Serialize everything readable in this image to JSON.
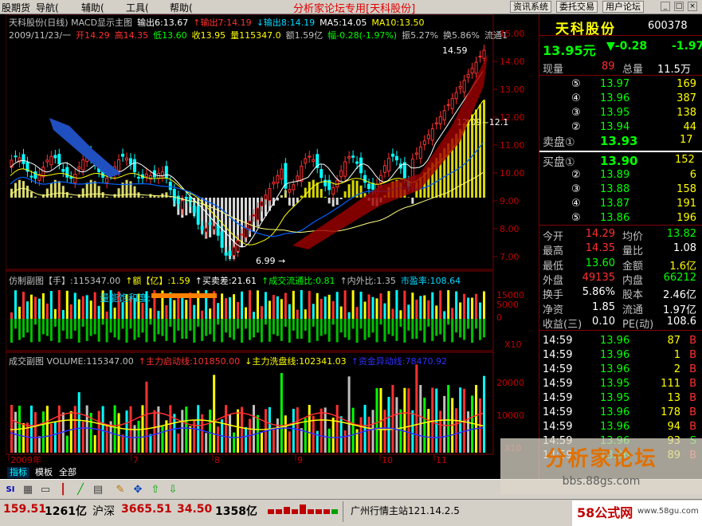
{
  "menu": {
    "items": [
      "股期货",
      "导航(",
      "辅助(",
      "工具(",
      "帮助("
    ],
    "title": "分析家论坛专用[天科股份]",
    "buttons": [
      "资讯系统",
      "委托交易",
      "用户论坛"
    ]
  },
  "main_header": {
    "line1": [
      {
        "t": "天科股份(日线) MACD显示主图",
        "c": "#c0c0c0"
      },
      {
        "t": "输出6:13.67",
        "c": "#ffffff"
      },
      {
        "t": "↑输出7:14.19",
        "c": "#ff3030"
      },
      {
        "t": "↓输出8:14.19",
        "c": "#00d8ff"
      },
      {
        "t": "MA5:14.05",
        "c": "#ffffff"
      },
      {
        "t": "MA10:13.50",
        "c": "#ffff00"
      }
    ],
    "line2": [
      {
        "t": "2009/11/23/一",
        "c": "#c0c0c0"
      },
      {
        "t": "开14.29",
        "c": "#ff3030"
      },
      {
        "t": "高14.35",
        "c": "#ff3030"
      },
      {
        "t": "低13.60",
        "c": "#00ff00"
      },
      {
        "t": "收13.95",
        "c": "#ffff00"
      },
      {
        "t": "量115347.0",
        "c": "#ffff00"
      },
      {
        "t": "额1.59亿",
        "c": "#c0c0c0"
      },
      {
        "t": "幅-0.28(-1.97%)",
        "c": "#00ff00"
      },
      {
        "t": "振5.27%",
        "c": "#c0c0c0"
      },
      {
        "t": "换5.86%",
        "c": "#c0c0c0"
      },
      {
        "t": "流通1",
        "c": "#c0c0c0"
      }
    ],
    "price_labels": [
      "15.00",
      "14.00",
      "13.00",
      "12.00",
      "11.00",
      "10.00",
      "9.00",
      "8.00",
      "7.00"
    ],
    "annot_high": "14.59",
    "annot_low": "6.99",
    "annot_mid": "12.09~12.1"
  },
  "sub1_header": [
    {
      "t": "仿制副图【手】:115347.00",
      "c": "#c0c0c0"
    },
    {
      "t": "↑额【亿】:1.59",
      "c": "#ffff00"
    },
    {
      "t": "↑买卖差:21.61",
      "c": "#ffffff"
    },
    {
      "t": "↑成交流通比:0.81",
      "c": "#00ff00"
    },
    {
      "t": "↑内外比:1.35",
      "c": "#c0c0c0"
    },
    {
      "t": "市盈率:108.64",
      "c": "#00d8ff"
    }
  ],
  "sub1": {
    "label": "量能饱和度:",
    "y_labels": [
      "15000",
      "5000",
      "0"
    ],
    "x10": "X10"
  },
  "sub2_header": [
    {
      "t": "成交副图 VOLUME:115347.00",
      "c": "#c0c0c0"
    },
    {
      "t": "↑主力启动线:101850.00",
      "c": "#ff3030"
    },
    {
      "t": "↓主力洗盘线:102341.03",
      "c": "#ffff00"
    },
    {
      "t": "↑资金异动线:78470.92",
      "c": "#3030ff"
    }
  ],
  "sub2": {
    "y_labels": [
      "20000",
      "10000"
    ],
    "x10": "X10"
  },
  "time_axis": [
    "2009年",
    "7",
    "8",
    "9",
    "10",
    "11"
  ],
  "quote": {
    "name": "天科股份",
    "code": "600378",
    "price": "13.95元",
    "change": "▼-0.28",
    "change_pct": "-1.97",
    "now_vol_label": "现量",
    "now_vol": "89",
    "total_vol_label": "总量",
    "total_vol": "11.5万",
    "sells": [
      {
        "lvl": "⑤",
        "price": "13.97",
        "vol": "169"
      },
      {
        "lvl": "④",
        "price": "13.96",
        "vol": "387"
      },
      {
        "lvl": "③",
        "price": "13.95",
        "vol": "138"
      },
      {
        "lvl": "②",
        "price": "13.94",
        "vol": "44"
      }
    ],
    "sell1_label": "卖盘①",
    "sell1_price": "13.93",
    "sell1_vol": "17",
    "buy1_label": "买盘①",
    "buy1_price": "13.90",
    "buy1_vol": "152",
    "buys": [
      {
        "lvl": "②",
        "price": "13.89",
        "vol": "6"
      },
      {
        "lvl": "③",
        "price": "13.88",
        "vol": "158"
      },
      {
        "lvl": "④",
        "price": "13.87",
        "vol": "191"
      },
      {
        "lvl": "⑤",
        "price": "13.86",
        "vol": "196"
      }
    ],
    "stats": [
      {
        "l1": "今开",
        "v1": "14.29",
        "c1": "#ff3030",
        "l2": "均价",
        "v2": "13.82",
        "c2": "#00ff00"
      },
      {
        "l1": "最高",
        "v1": "14.35",
        "c1": "#ff3030",
        "l2": "量比",
        "v2": "1.08",
        "c2": "#ffffff"
      },
      {
        "l1": "最低",
        "v1": "13.60",
        "c1": "#00ff00",
        "l2": "金额",
        "v2": "1.6亿",
        "c2": "#ffff00"
      },
      {
        "l1": "外盘",
        "v1": "49135",
        "c1": "#ff3030",
        "l2": "内盘",
        "v2": "66212",
        "c2": "#00ff00"
      },
      {
        "l1": "换手",
        "v1": "5.86%",
        "c1": "#ffffff",
        "l2": "股本",
        "v2": "2.46亿",
        "c2": "#ffffff"
      },
      {
        "l1": "净资",
        "v1": "1.85",
        "c1": "#ffffff",
        "l2": "流通",
        "v2": "1.97亿",
        "c2": "#ffffff"
      },
      {
        "l1": "收益(三)",
        "v1": "0.10",
        "c1": "#ffffff",
        "l2": "PE(动)",
        "v2": "108.6",
        "c2": "#ffffff"
      }
    ],
    "ticks": [
      {
        "t": "14:59",
        "p": "13.96",
        "v": "87",
        "s": "B"
      },
      {
        "t": "14:59",
        "p": "13.96",
        "v": "1",
        "s": "B"
      },
      {
        "t": "14:59",
        "p": "13.96",
        "v": "2",
        "s": "B"
      },
      {
        "t": "14:59",
        "p": "13.95",
        "v": "111",
        "s": "B"
      },
      {
        "t": "14:59",
        "p": "13.95",
        "v": "13",
        "s": "B"
      },
      {
        "t": "14:59",
        "p": "13.96",
        "v": "178",
        "s": "B"
      },
      {
        "t": "14:59",
        "p": "13.96",
        "v": "94",
        "s": "B"
      },
      {
        "t": "14:59",
        "p": "13.96",
        "v": "93",
        "s": "S"
      },
      {
        "t": "14:59",
        "p": "13.96",
        "v": "89",
        "s": "B"
      }
    ]
  },
  "tabs": [
    "指标",
    "模板",
    "全部"
  ],
  "status": {
    "v1": "159.51",
    "v2": "1261亿",
    "idx_name": "沪深",
    "idx_val": "3665.51",
    "idx_chg": "34.50",
    "idx_amt": "1358亿",
    "server": "广州行情主站121.14.2.5"
  },
  "watermark": {
    "title": "分析家论坛",
    "url": "bbs.88gs.com",
    "brand": "58公式网",
    "brand_url": "www.58gu.com"
  }
}
